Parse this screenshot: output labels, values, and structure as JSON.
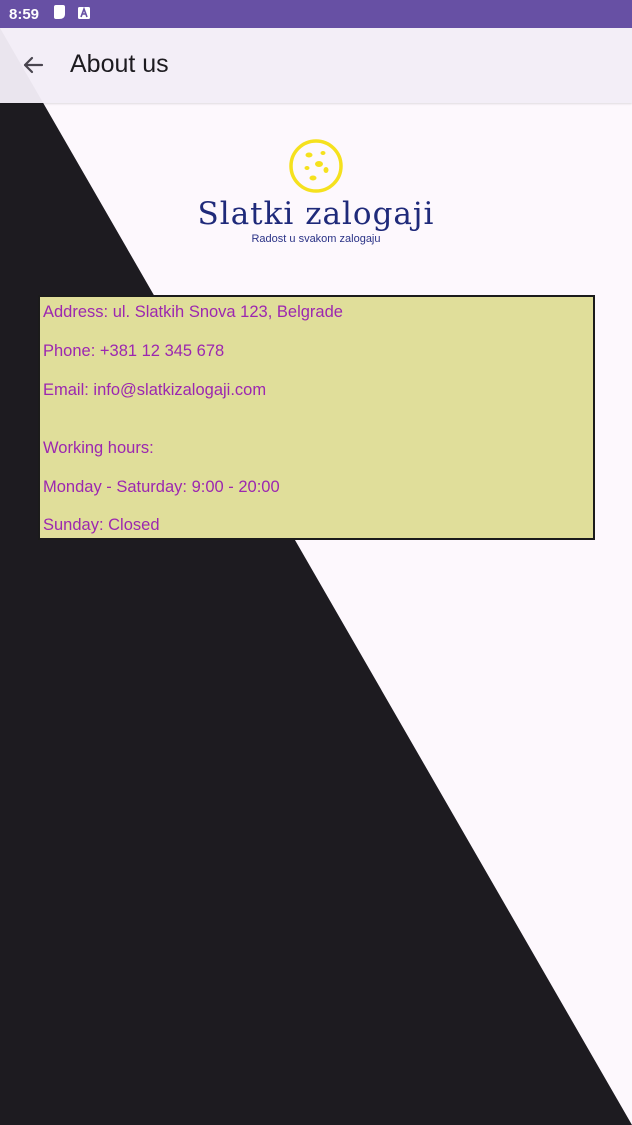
{
  "status_bar": {
    "time": "8:59",
    "icons": [
      "notification-icon",
      "a-letter-icon"
    ]
  },
  "app_bar": {
    "back_icon": "arrow-back-icon",
    "title": "About us"
  },
  "logo": {
    "brand": "Slatki zalogaji",
    "tagline": "Radost u svakom zalogaju",
    "cookie_color": "#f5e11e",
    "brand_color": "#1f2a7a"
  },
  "info": {
    "address": "Address: ul. Slatkih Snova 123, Belgrade",
    "phone": "Phone: +381 12 345 678",
    "email": "Email: info@slatkizalogaji.com",
    "hours_heading": "Working hours:",
    "weekdays": "Monday - Saturday: 9:00 - 20:00",
    "sunday": "Sunday: Closed",
    "text_color": "#9c27b0",
    "box_color": "#e0de9a"
  },
  "colors": {
    "status_bar": "#6750a4",
    "app_bar": "#f3edf7",
    "background_light": "#fdf8fd",
    "background_dark": "#1d1b20"
  }
}
